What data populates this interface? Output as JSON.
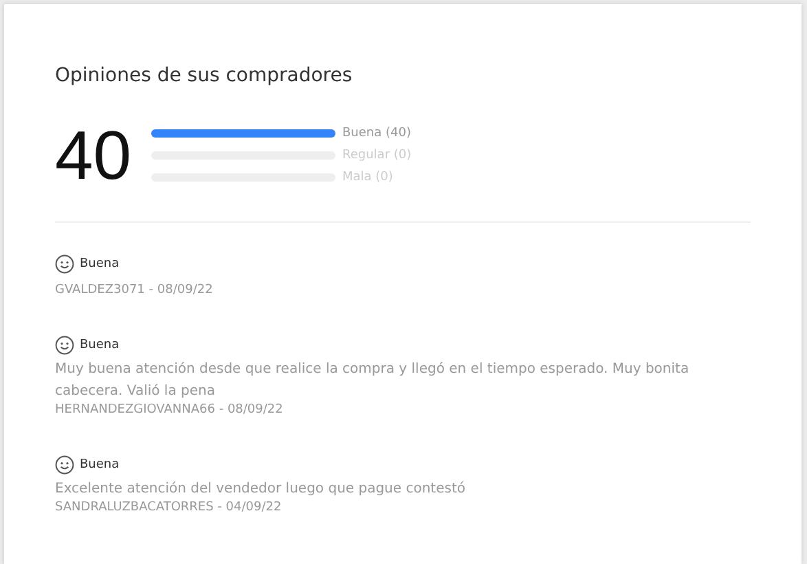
{
  "title": "Opiniones de sus compradores",
  "summary": {
    "count": "40",
    "ratings": [
      {
        "label": "Buena (40)",
        "level": 1
      },
      {
        "label": "Regular (0)",
        "level": 0
      },
      {
        "label": "Mala (0)",
        "level": 0
      }
    ]
  },
  "reviews": [
    {
      "rating": "Buena",
      "author": "GVALDEZ3071 - 08/09/22"
    },
    {
      "rating": "Buena",
      "text": "Muy buena atención desde que realice la compra y llegó en el tiempo esperado. Muy bonita cabecera. Valió la pena",
      "author": "HERNANDEZGIOVANNA66 - 08/09/22"
    },
    {
      "rating": "Buena",
      "text": "Excelente atención del vendedor luego que pague contestó",
      "author": "SANDRALUZBACATORRES - 04/09/22"
    }
  ]
}
